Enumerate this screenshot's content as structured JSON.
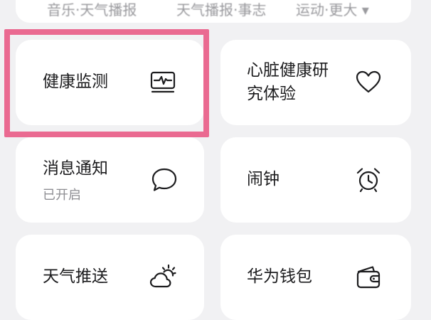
{
  "top_row": {
    "cut_items": [
      "音乐·天气播报",
      "天气播报·事志",
      "运动·更大 ▾"
    ]
  },
  "cards": {
    "health_monitor": {
      "title": "健康监测",
      "icon": "heart-rate-monitor-icon"
    },
    "heart_research": {
      "title_line1": "心脏健康研",
      "title_line2": "究体验",
      "icon": "heart-icon"
    },
    "notifications": {
      "title": "消息通知",
      "status": "已开启",
      "icon": "chat-bubble-icon"
    },
    "alarm": {
      "title": "闹钟",
      "icon": "alarm-clock-icon"
    },
    "weather_push": {
      "title": "天气推送",
      "icon": "sun-cloud-icon"
    },
    "huawei_wallet": {
      "title": "华为钱包",
      "icon": "wallet-icon"
    }
  },
  "colors": {
    "background": "#f1f1f3",
    "card": "#ffffff",
    "highlight": "#ea6a91",
    "secondary_text": "#8e8e93"
  }
}
